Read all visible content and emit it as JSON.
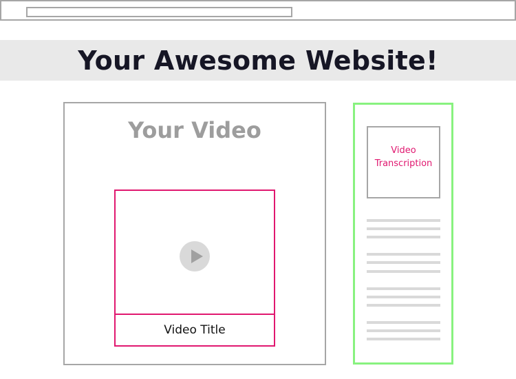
{
  "site": {
    "title": "Your Awesome Website!"
  },
  "video_panel": {
    "heading": "Your Video",
    "player_title": "Video Title"
  },
  "sidebar": {
    "transcription_label": "Video\nTranscription"
  },
  "colors": {
    "accent_pink": "#e0176f",
    "sidebar_green": "#88f27f",
    "frame_gray": "#a6a6a6",
    "banner_gray": "#e9e9e9",
    "placeholder_gray": "#d9d9d9"
  },
  "icons": {
    "play": "play-icon"
  }
}
